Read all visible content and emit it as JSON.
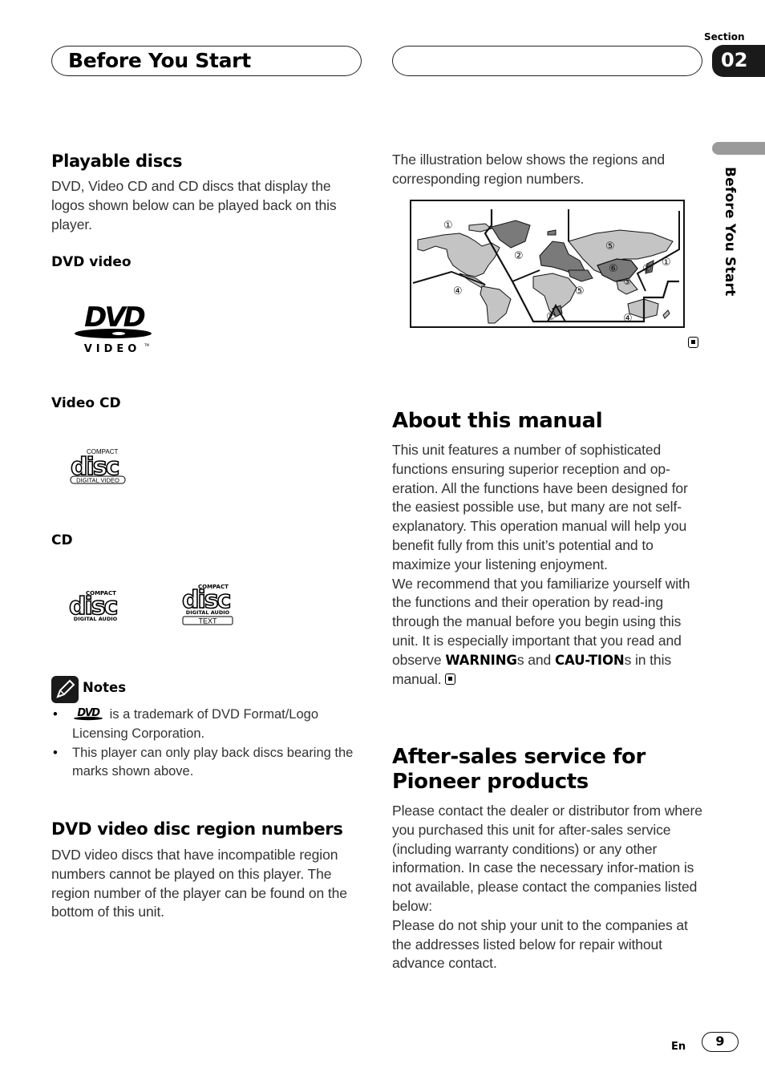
{
  "header": {
    "title": "Before You Start",
    "section_label": "Section",
    "section_number": "02"
  },
  "side_tab": {
    "label": "Before You Start"
  },
  "playable_discs": {
    "heading": "Playable discs",
    "intro": "DVD, Video CD and CD discs that display the logos shown below can be played back on this player.",
    "dvd_video": {
      "label": "DVD video",
      "logo_text": "DVD",
      "logo_subtext": "VIDEO",
      "logo_tm": "TM"
    },
    "video_cd": {
      "label": "Video CD",
      "logo_top": "COMPACT",
      "logo_main": "disc",
      "logo_bottom": "DIGITAL VIDEO"
    },
    "cd": {
      "label": "CD",
      "logos": [
        {
          "top": "COMPACT",
          "main": "disc",
          "bottom": "DIGITAL AUDIO",
          "extra": ""
        },
        {
          "top": "COMPACT",
          "main": "disc",
          "bottom": "DIGITAL AUDIO",
          "extra": "TEXT"
        }
      ]
    }
  },
  "notes": {
    "label": "Notes",
    "items": [
      {
        "inline_logo": "DVD",
        "text_line1": " is a trademark of DVD Format/Logo",
        "text_line2": "Licensing Corporation."
      },
      {
        "text": "This player can only play back discs bearing the marks shown above."
      }
    ]
  },
  "region_numbers": {
    "heading": "DVD video disc region numbers",
    "body": "DVD video discs that have incompatible region numbers cannot be played on this player. The region number of the player can be found on the bottom of this unit."
  },
  "region_map": {
    "intro": "The illustration below shows the regions and corresponding region numbers.",
    "labels": [
      "①",
      "②",
      "④",
      "②",
      "⑤",
      "⑤",
      "⑥",
      "②",
      "①",
      "③",
      "②",
      "④"
    ]
  },
  "about_manual": {
    "heading": "About this manual",
    "body_part1": "This unit features a number of sophisticated functions ensuring superior reception and op-eration. All the functions have been designed for the easiest possible use, but many are not self-explanatory. This operation manual will help you benefit fully from this unit’s potential and to maximize your listening enjoyment.",
    "body_part2_prefix": "We recommend that you familiarize yourself with the functions and their operation by read-ing through the manual before you begin using this unit. It is especially important that you read and observe ",
    "warning_word": "WARNING",
    "mid_text": "s and ",
    "caution_word": "CAU-TION",
    "suffix": "s in this manual."
  },
  "after_sales": {
    "heading_line1": "After-sales service for",
    "heading_line2": "Pioneer products",
    "body_part1": "Please contact the dealer or distributor from where you purchased this unit for after-sales service (including warranty conditions) or any other information. In case the necessary infor-mation is not available, please contact the companies listed below:",
    "body_part2": "Please do not ship your unit to the companies at the addresses listed below for repair without advance contact."
  },
  "footer": {
    "language": "En",
    "page_number": "9"
  },
  "colors": {
    "text": "#333333",
    "heading": "#000000",
    "region_dark": "#7a7a7a",
    "region_light": "#c4c4c4",
    "tab_dark": "#1a1a1a",
    "tab_gray": "#9a9a9a"
  }
}
